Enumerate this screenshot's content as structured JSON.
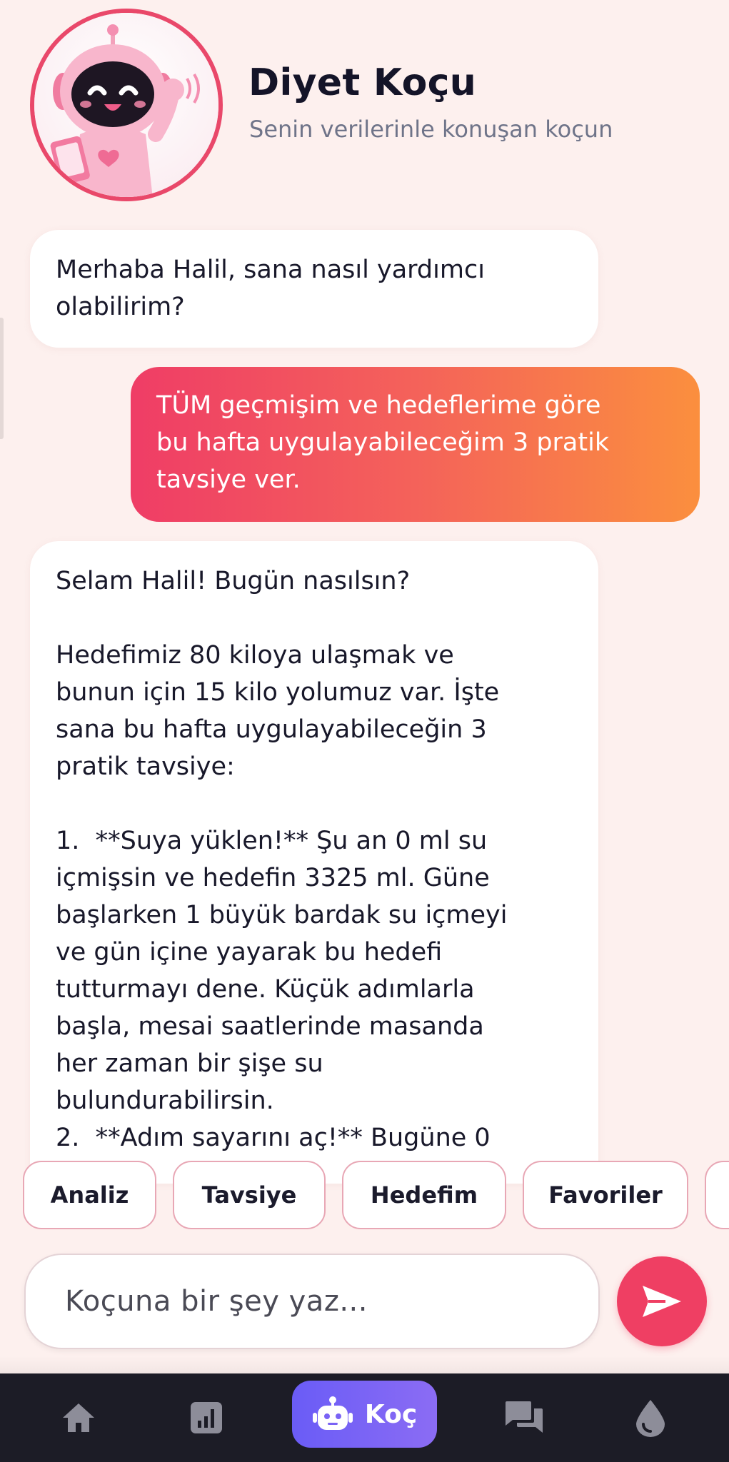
{
  "header": {
    "title": "Diyet Koçu",
    "subtitle": "Senin verilerinle konuşan koçun",
    "avatar_icon": "robot-mascot-icon"
  },
  "messages": [
    {
      "role": "bot",
      "text": "Merhaba Halil, sana nasıl yardımcı\nolabilirim?"
    },
    {
      "role": "user",
      "text": "TÜM geçmişim ve hedeflerime göre\nbu hafta uygulayabileceğim 3 pratik\ntavsiye ver."
    },
    {
      "role": "bot",
      "text": "Selam Halil! Bugün nasılsın?\n\nHedefimiz 80 kiloya ulaşmak ve\nbunun için 15 kilo yolumuz var. İşte\nsana bu hafta uygulayabileceğin 3\npratik tavsiye:\n\n1.  **Suya yüklen!** Şu an 0 ml su\niçmişsin ve hedefin 3325 ml. Güne\nbaşlarken 1 büyük bardak su içmeyi\nve gün içine yayarak bu hedefi\ntutturmayı dene. Küçük adımlarla\nbaşla, mesai saatlerinde masanda\nher zaman bir şişe su\nbulundurabilirsin.\n2.  **Adım sayarını aç!** Bugüne 0"
    }
  ],
  "chips": [
    "Analiz",
    "Tavsiye",
    "Hedefim",
    "Favoriler"
  ],
  "input": {
    "placeholder": "Koçuna bir şey yaz..."
  },
  "nav": {
    "items": [
      "home-icon",
      "stats-icon",
      "chat-icon",
      "water-drop-icon"
    ],
    "active_label": "Koç",
    "active_icon": "robot-icon"
  },
  "colors": {
    "background": "#fdf0ee",
    "accent": "#ef3f63",
    "user_gradient_start": "#ef3d66",
    "user_gradient_end": "#fb8f3e",
    "nav_background": "#1c1c26",
    "nav_active": "#6a5cf6"
  }
}
